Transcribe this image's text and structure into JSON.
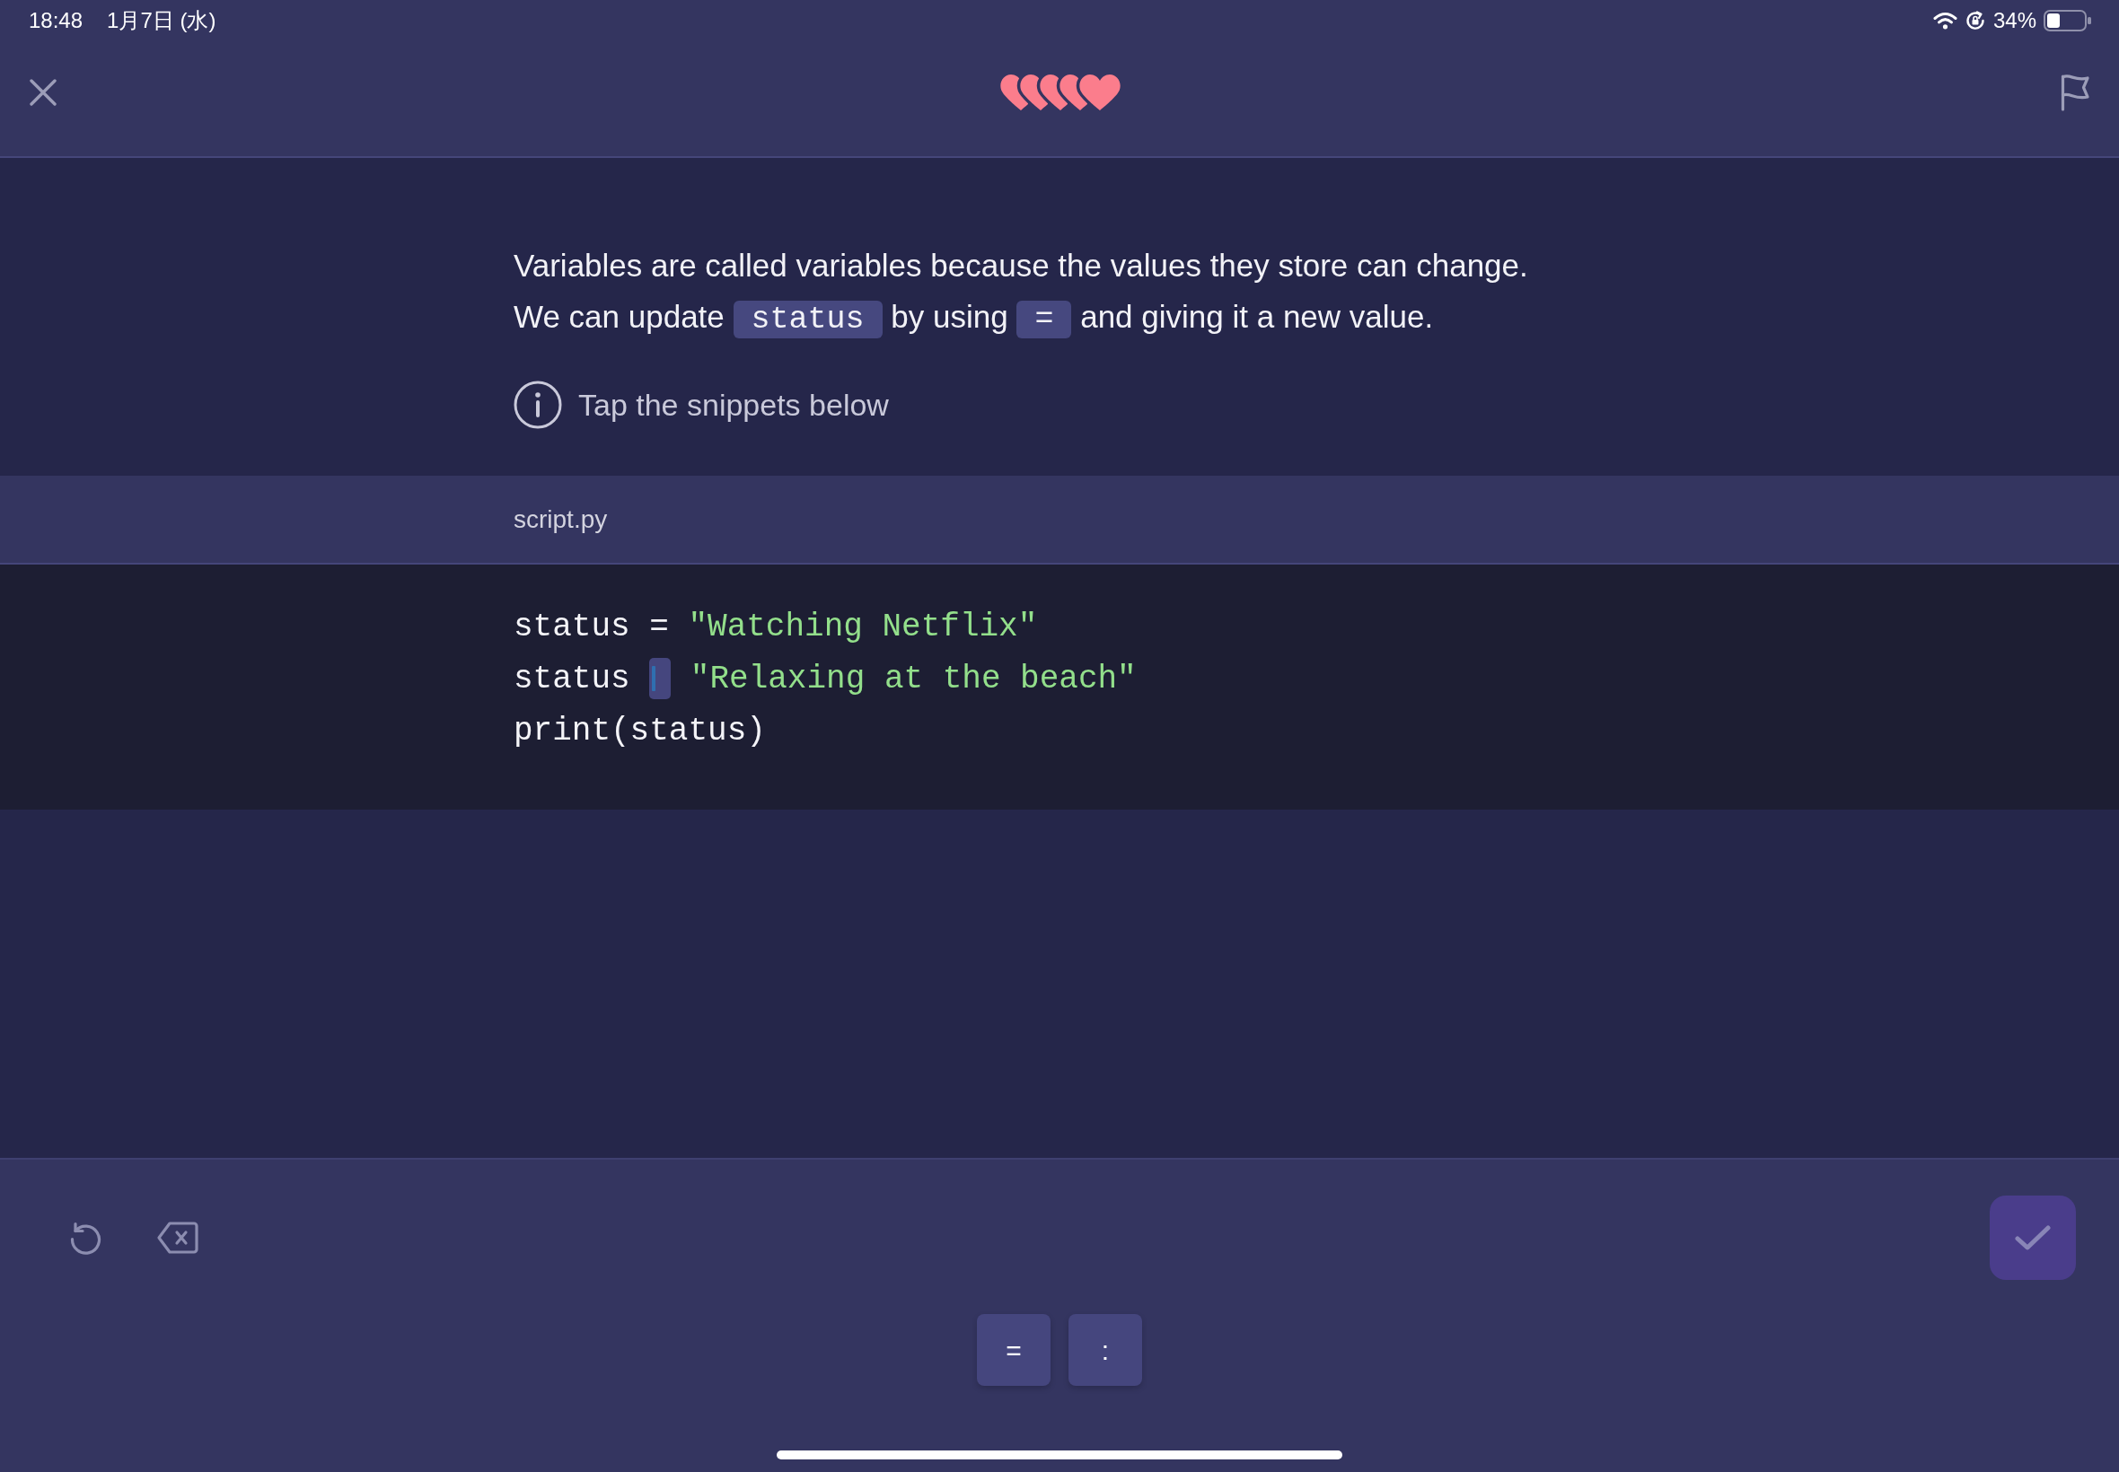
{
  "status_bar": {
    "time": "18:48",
    "date": "1月7日 (水)",
    "battery": "34%"
  },
  "header": {
    "lives": [
      {
        "full": true
      },
      {
        "full": true
      },
      {
        "full": true
      },
      {
        "full": true
      },
      {
        "full": true
      }
    ]
  },
  "lesson": {
    "lines": [
      [
        {
          "kind": "text",
          "text": "Variables are called variables because the values they store can change."
        }
      ],
      [
        {
          "kind": "text",
          "text": "We can update"
        },
        {
          "kind": "code",
          "text": "status"
        },
        {
          "kind": "text",
          "text": "by using"
        },
        {
          "kind": "code",
          "text": "="
        },
        {
          "kind": "text",
          "text": "and giving it a new value."
        }
      ]
    ],
    "hint": "Tap the snippets below"
  },
  "editor": {
    "file_name": "script.py",
    "lines": [
      [
        {
          "kind": "code",
          "text": "status"
        },
        {
          "kind": "code",
          "text": "="
        },
        {
          "kind": "string",
          "text": "\"Watching Netflix\""
        }
      ],
      [
        {
          "kind": "code",
          "text": "status"
        },
        {
          "kind": "blank",
          "focused": true
        },
        {
          "kind": "string",
          "text": "\"Relaxing at the beach\""
        }
      ],
      [
        {
          "kind": "code",
          "text": "print(status)"
        }
      ]
    ]
  },
  "toolbar": {
    "check": {
      "disabled": true
    }
  },
  "snippets": [
    {
      "text": "="
    },
    {
      "text": ":"
    }
  ]
}
